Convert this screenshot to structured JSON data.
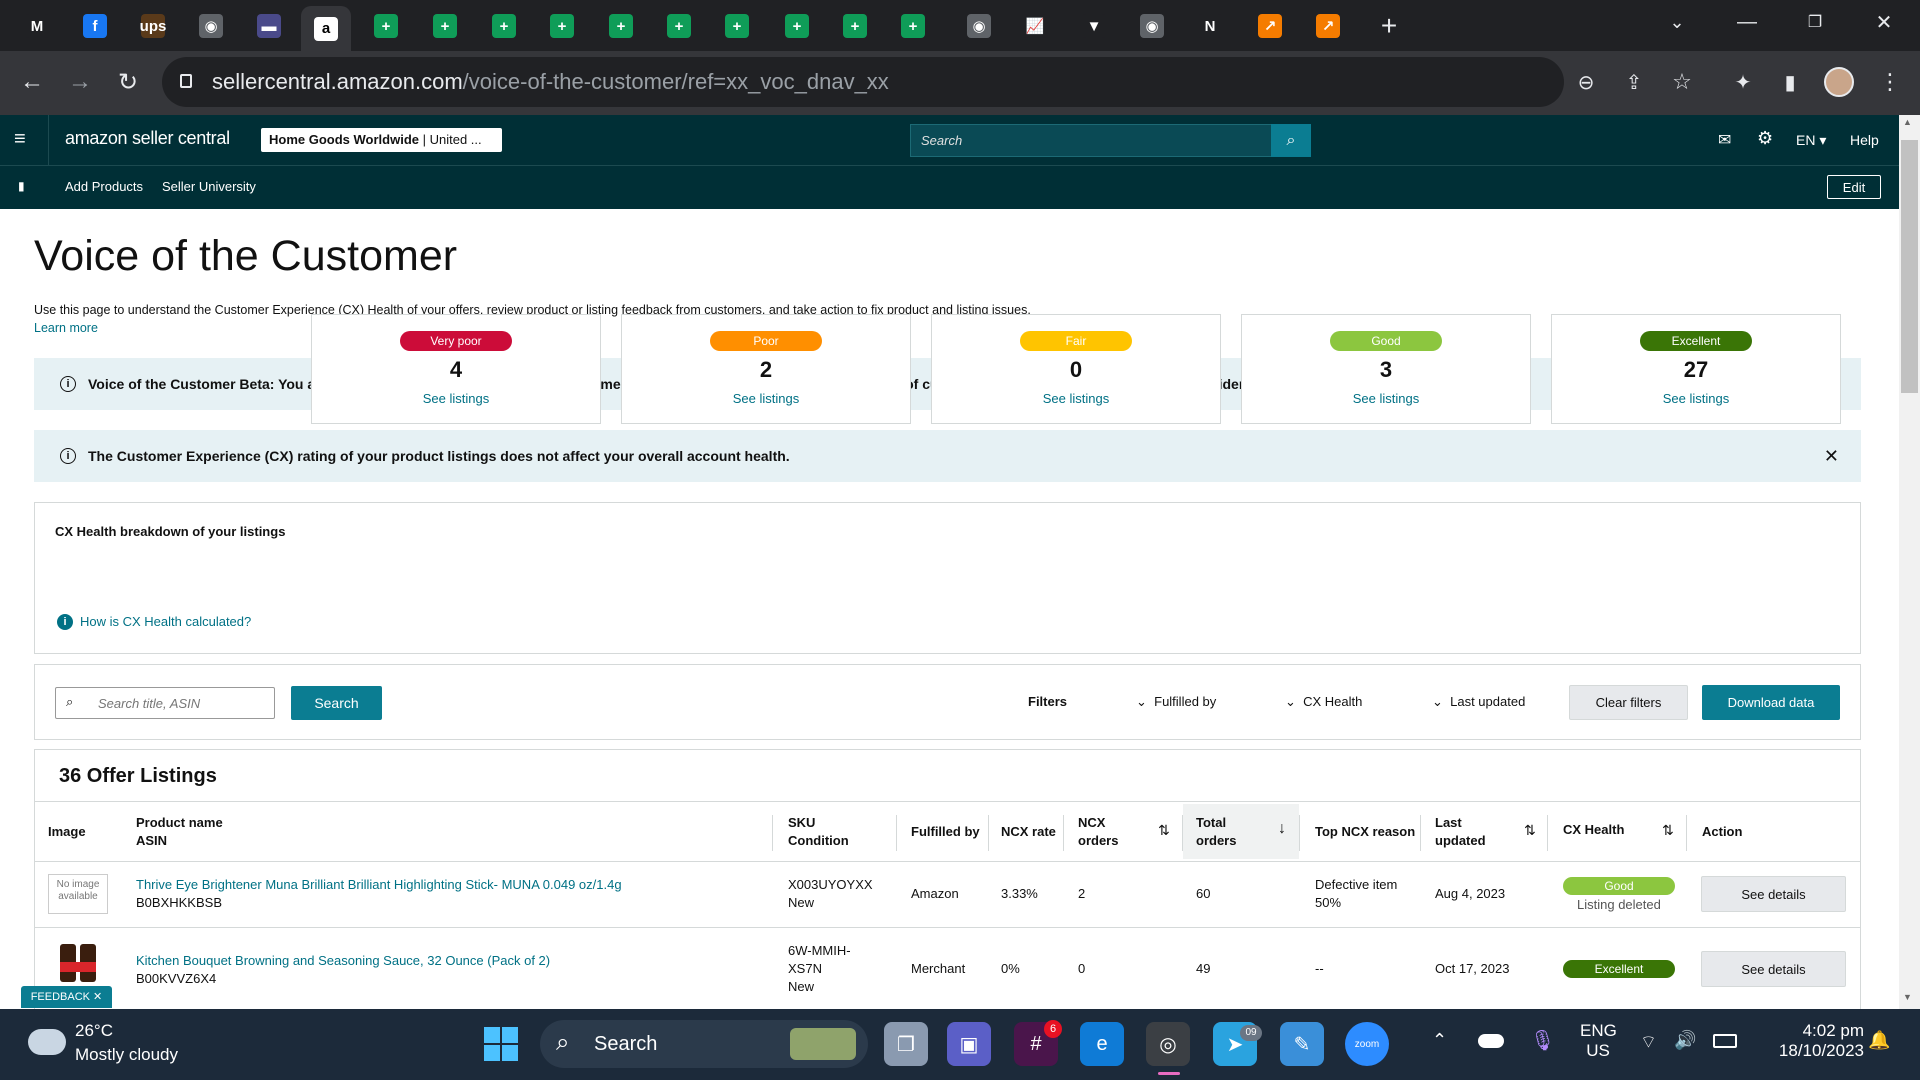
{
  "browser": {
    "url_host": "sellercentral.amazon.com",
    "url_path": "/voice-of-the-customer/ref=xx_voc_dnav_xx",
    "new_tab_symbol": "+",
    "tab_glyphs": [
      "M",
      "f",
      "ups",
      "◉",
      "▬",
      "a",
      "+",
      "+",
      "+",
      "+",
      "+",
      "+",
      "+",
      "+",
      "+",
      "+",
      "◉",
      "📈",
      "▼",
      "◉",
      "N",
      "↗",
      "↗"
    ],
    "tab_colors": [
      "#202124",
      "#1877f2",
      "#5a3a1a",
      "#5f6368",
      "#4a4a8a",
      "#000000",
      "#0f9d58",
      "#0f9d58",
      "#0f9d58",
      "#0f9d58",
      "#0f9d58",
      "#0f9d58",
      "#0f9d58",
      "#0f9d58",
      "#0f9d58",
      "#0f9d58",
      "#5f6368",
      "#202124",
      "#202124",
      "#5f6368",
      "#202124",
      "#f57c00",
      "#f57c00"
    ]
  },
  "seller_header": {
    "logo": "amazon seller central",
    "account_bold": "Home Goods Worldwide",
    "account_rest": " | United ...",
    "search_placeholder": "Search",
    "language": "EN",
    "help": "Help",
    "sub_links": [
      "Add Products",
      "Seller University"
    ],
    "edit": "Edit"
  },
  "page": {
    "title": "Voice of the Customer",
    "description": "Use this page to understand the Customer Experience (CX) Health of your offers, review product or listing feedback from customers, and take action to fix product and listing issues.",
    "learn_more": "Learn more",
    "banner1": "Voice of the Customer Beta: You are experiencing the new Voice of the Customer Dashboard. We have added new sources of customer feedback and insights to help you identify customer trends.",
    "banner2": "The Customer Experience (CX) rating of your product listings does not affect your overall account health.",
    "breakdown_title": "CX Health breakdown of your listings",
    "how_calculated": "How is CX Health calculated?",
    "cards": [
      {
        "label": "Very poor",
        "count": "4",
        "link": "See listings",
        "color": "#cc0c39"
      },
      {
        "label": "Poor",
        "count": "2",
        "link": "See listings",
        "color": "#ff8f00"
      },
      {
        "label": "Fair",
        "count": "0",
        "link": "See listings",
        "color": "#ffc400"
      },
      {
        "label": "Good",
        "count": "3",
        "link": "See listings",
        "color": "#8cc63f"
      },
      {
        "label": "Excellent",
        "count": "27",
        "link": "See listings",
        "color": "#3a7506"
      }
    ],
    "search_placeholder": "Search title, ASIN",
    "search_button": "Search",
    "filters_label": "Filters",
    "filter_options": [
      "Fulfilled by",
      "CX Health",
      "Last updated"
    ],
    "clear_filters": "Clear filters",
    "download": "Download data",
    "listings_title": "36 Offer Listings",
    "columns": {
      "image": "Image",
      "product_name": "Product name",
      "asin": "ASIN",
      "sku": "SKU",
      "condition": "Condition",
      "fulfilled_by": "Fulfilled by",
      "ncx_rate": "NCX rate",
      "ncx_orders_1": "NCX",
      "ncx_orders_2": "orders",
      "total_orders_1": "Total",
      "total_orders_2": "orders",
      "top_reason": "Top NCX reason",
      "last_updated_1": "Last",
      "last_updated_2": "updated",
      "cx_health": "CX Health",
      "action": "Action"
    },
    "rows": [
      {
        "image_text": "No image available",
        "name": "Thrive Eye Brightener Muna Brilliant Brilliant Highlighting Stick- MUNA 0.049 oz/1.4g",
        "asin": "B0BXHKKBSB",
        "sku": "X003UYOYXX",
        "condition": "New",
        "fulfilled_by": "Amazon",
        "ncx_rate": "3.33%",
        "ncx_orders": "2",
        "total_orders": "60",
        "reason": "Defective item",
        "reason_pct": "50%",
        "updated": "Aug 4, 2023",
        "health": "Good",
        "health_color": "#8cc63f",
        "health_note": "Listing deleted",
        "action": "See details"
      },
      {
        "image_text": "",
        "name": "Kitchen Bouquet Browning and Seasoning Sauce, 32 Ounce (Pack of 2)",
        "asin": "B00KVVZ6X4",
        "sku": "6W-MMIH-",
        "sku2": "XS7N",
        "condition": "New",
        "fulfilled_by": "Merchant",
        "ncx_rate": "0%",
        "ncx_orders": "0",
        "total_orders": "49",
        "reason": "--",
        "reason_pct": "",
        "updated": "Oct 17, 2023",
        "health": "Excellent",
        "health_color": "#3a7506",
        "health_note": "",
        "action": "See details"
      }
    ],
    "feedback": "FEEDBACK"
  },
  "taskbar": {
    "temp": "26°C",
    "weather": "Mostly cloudy",
    "search": "Search",
    "lang1": "ENG",
    "lang2": "US",
    "time": "4:02 pm",
    "date": "18/10/2023",
    "slack_badge": "6",
    "telegram_badge": "09",
    "zoom": "zoom"
  }
}
